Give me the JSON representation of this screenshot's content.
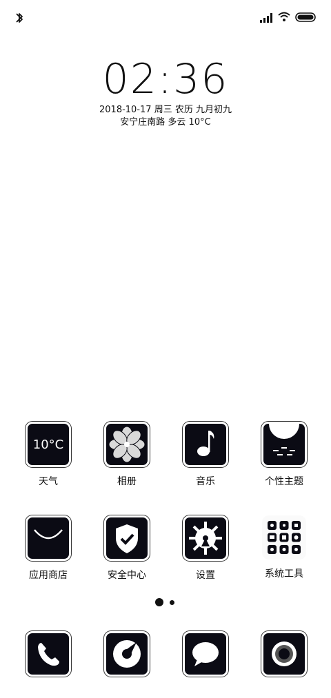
{
  "status_bar": {
    "left_icon": "bluetooth-icon",
    "right_icons": [
      "cellular-signal-icon",
      "wifi-icon",
      "battery-icon"
    ]
  },
  "lockscreen_widget": {
    "time": "02:36",
    "date_line": "2018-10-17 周三 农历 九月初九",
    "location_weather": "安宁庄南路 多云 10°C"
  },
  "apps_row1": [
    {
      "label": "天气",
      "icon": "weather-icon",
      "icon_text": "10°C"
    },
    {
      "label": "相册",
      "icon": "gallery-flower-icon"
    },
    {
      "label": "音乐",
      "icon": "music-note-icon"
    },
    {
      "label": "个性主题",
      "icon": "themes-icon"
    }
  ],
  "apps_row2": [
    {
      "label": "应用商店",
      "icon": "app-store-smile-icon"
    },
    {
      "label": "安全中心",
      "icon": "security-shield-icon"
    },
    {
      "label": "设置",
      "icon": "settings-gear-icon"
    },
    {
      "label": "系统工具",
      "icon": "system-tools-folder-icon"
    }
  ],
  "page_indicator": {
    "pages": 2,
    "current": 1
  },
  "dock": [
    {
      "icon": "phone-icon"
    },
    {
      "icon": "browser-compass-icon"
    },
    {
      "icon": "messages-bubble-icon"
    },
    {
      "icon": "camera-lens-icon"
    }
  ],
  "colors": {
    "background": "#ffffff",
    "icon_bg": "#0b0b14",
    "text": "#111111"
  }
}
